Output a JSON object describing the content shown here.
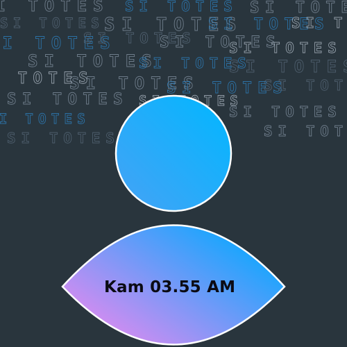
{
  "background": {
    "base_color": "#29353d",
    "pattern_text": "SI TOTES",
    "pattern_colors": [
      "#8796a6",
      "#2d86c8",
      "#5a6b7c",
      "#b5c0cc"
    ]
  },
  "avatar": {
    "icon": "user-icon",
    "head_gradient": [
      "#46a2f5",
      "#00b7ff"
    ],
    "body_gradient": [
      "#ff86ee",
      "#00a9ff"
    ],
    "stroke_color": "#ffffff"
  },
  "clock": {
    "text": "Kam 03.55 AM"
  }
}
